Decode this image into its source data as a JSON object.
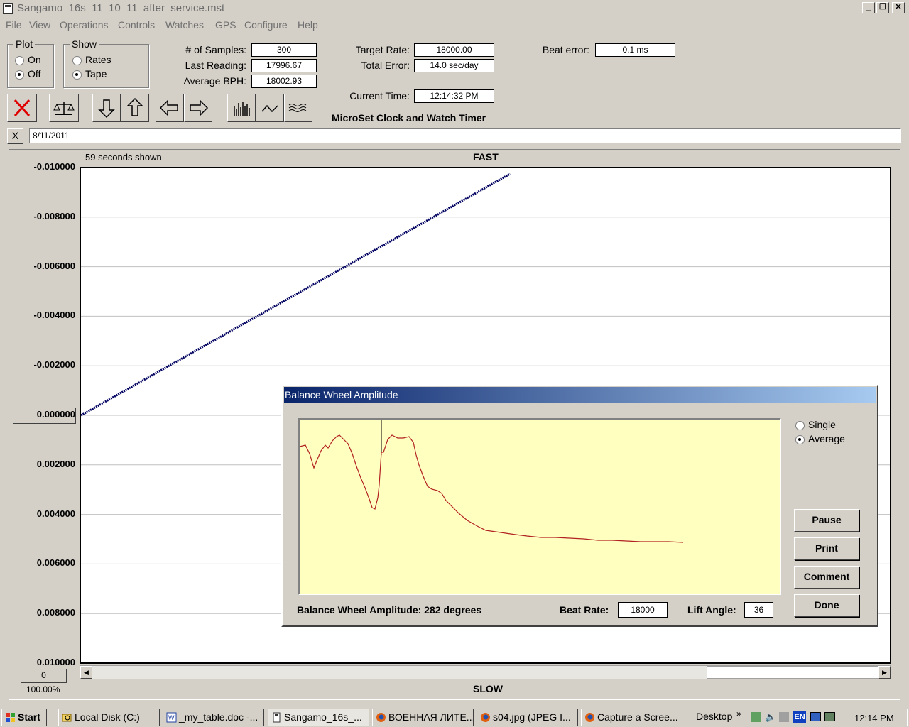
{
  "window": {
    "title": "Sangamo_16s_11_10_11_after_service.mst"
  },
  "menu": [
    "File",
    "View",
    "Operations",
    "Controls",
    "Watches",
    "GPS",
    "Configure",
    "Help"
  ],
  "plot_group": {
    "title": "Plot",
    "on": "On",
    "off": "Off",
    "selected": "Off"
  },
  "show_group": {
    "title": "Show",
    "rates": "Rates",
    "tape": "Tape",
    "selected": "Tape"
  },
  "stats": {
    "samples_label": "# of Samples:",
    "samples": "300",
    "last_reading_label": "Last Reading:",
    "last_reading": "17996.67",
    "avg_bph_label": "Average BPH:",
    "avg_bph": "18002.93",
    "target_rate_label": "Target Rate:",
    "target_rate": "18000.00",
    "total_error_label": "Total Error:",
    "total_error": "14.0 sec/day",
    "current_time_label": "Current Time:",
    "current_time": "12:14:32 PM",
    "beat_error_label": "Beat error:",
    "beat_error": "0.1 ms",
    "app_name": "MicroSet Clock and Watch Timer"
  },
  "note": {
    "close": "X",
    "text": "8/11/2011"
  },
  "tape_chart": {
    "seconds_shown": "59 seconds shown",
    "top_label": "FAST",
    "bottom_label": "SLOW",
    "y_ticks": [
      "-0.010000",
      "-0.008000",
      "-0.006000",
      "-0.004000",
      "-0.002000",
      "0.000000",
      "0.002000",
      "0.004000",
      "0.006000",
      "0.008000",
      "0.010000"
    ],
    "bottom_value": "0",
    "zoom": "100.00%"
  },
  "chart_data": {
    "type": "line",
    "ylim": [
      -0.01,
      0.01
    ],
    "x_seconds_range": [
      0,
      59
    ],
    "series": [
      {
        "x": [
          0,
          31.3
        ],
        "y": [
          0.0,
          -0.0098
        ]
      }
    ],
    "grid": true
  },
  "amplitude_dialog": {
    "title": "Balance Wheel Amplitude",
    "single": "Single",
    "average": "Average",
    "selected": "Average",
    "buttons": {
      "pause": "Pause",
      "print": "Print",
      "comment": "Comment",
      "done": "Done"
    },
    "amplitude_text": "Balance Wheel Amplitude: 282 degrees",
    "beat_rate_label": "Beat Rate:",
    "beat_rate": "18000",
    "lift_angle_label": "Lift Angle:",
    "lift_angle": "36",
    "line_color": "#b22222"
  },
  "taskbar": {
    "start": "Start",
    "tasks": [
      "Local Disk (C:)",
      "_my_table.doc -...",
      "Sangamo_16s_...",
      "ВОЕННАЯ ЛИТЕ...",
      "s04.jpg (JPEG I...",
      "Capture a Scree..."
    ],
    "desktop": "Desktop",
    "lang": "EN",
    "clock": "12:14 PM"
  }
}
